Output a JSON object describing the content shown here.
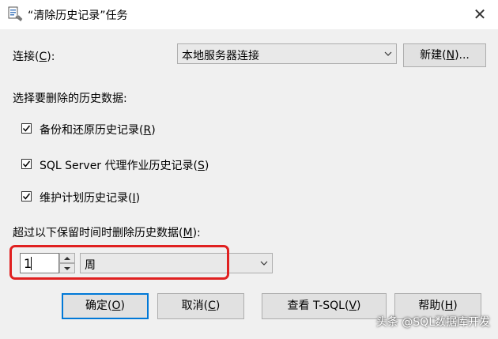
{
  "window": {
    "title": "“清除历史记录”任务",
    "close_glyph": "✕"
  },
  "connection": {
    "label": "连接",
    "accel": "C",
    "suffix": ":",
    "value": "本地服务器连接",
    "new_button_text": "新建",
    "new_button_accel": "N",
    "new_button_suffix": "..."
  },
  "select_history_label": "选择要删除的历史数据:",
  "options": [
    {
      "text": "备份和还原历史记录",
      "accel": "R",
      "checked": true
    },
    {
      "text": "SQL Server 代理作业历史记录",
      "accel": "S",
      "checked": true
    },
    {
      "text": "维护计划历史记录",
      "accel": "I",
      "checked": true
    }
  ],
  "retention": {
    "label": "超过以下保留时间时删除历史数据",
    "accel": "M",
    "suffix": ":",
    "number": "1",
    "unit": "周"
  },
  "buttons": {
    "ok_text": "确定",
    "ok_accel": "O",
    "cancel_text": "取消",
    "cancel_accel": "C",
    "tsql_text": "查看 T-SQL",
    "tsql_accel": "V",
    "help_text": "帮助",
    "help_accel": "H"
  },
  "watermark": "头条 @SQL数据库开发",
  "colors": {
    "highlight": "#e02020",
    "default_button_border": "#0078d7"
  }
}
